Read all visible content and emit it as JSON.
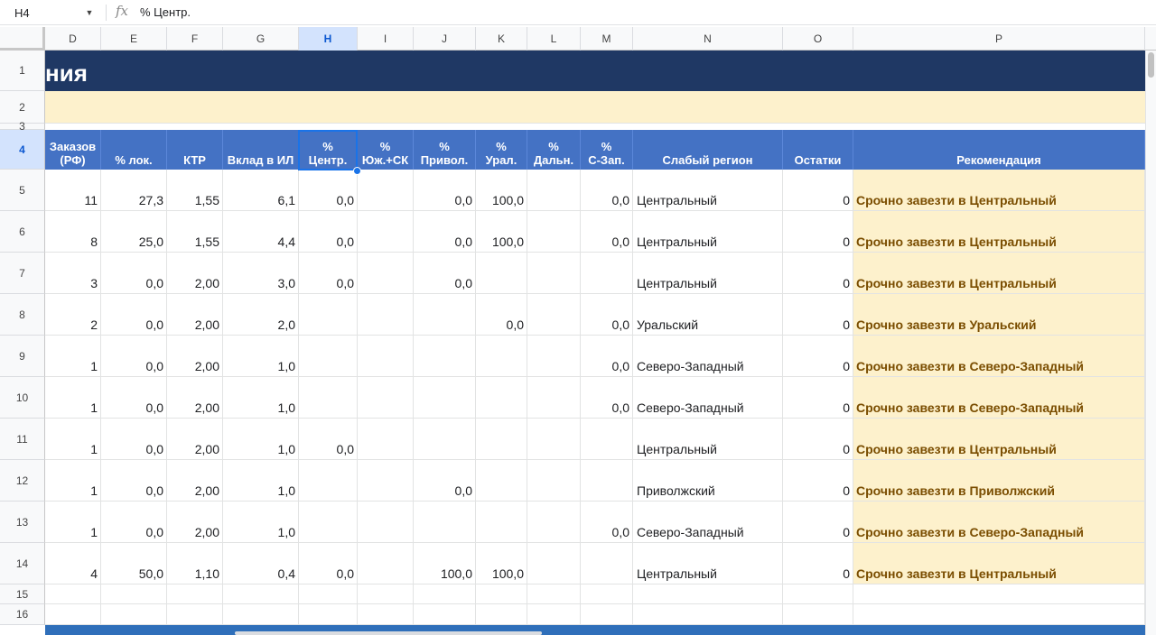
{
  "formula_bar": {
    "cell_ref": "H4",
    "fx_symbol": "fx",
    "formula": "% Центр."
  },
  "columns": [
    {
      "letter": "D",
      "selected": false
    },
    {
      "letter": "E",
      "selected": false
    },
    {
      "letter": "F",
      "selected": false
    },
    {
      "letter": "G",
      "selected": false
    },
    {
      "letter": "H",
      "selected": true
    },
    {
      "letter": "I",
      "selected": false
    },
    {
      "letter": "J",
      "selected": false
    },
    {
      "letter": "K",
      "selected": false
    },
    {
      "letter": "L",
      "selected": false
    },
    {
      "letter": "M",
      "selected": false
    },
    {
      "letter": "N",
      "selected": false
    },
    {
      "letter": "O",
      "selected": false
    },
    {
      "letter": "P",
      "selected": false
    }
  ],
  "row_numbers": [
    "1",
    "2",
    "3",
    "4",
    "5",
    "6",
    "7",
    "8",
    "9",
    "10",
    "11",
    "12",
    "13",
    "14",
    "15",
    "16"
  ],
  "selected_row": "4",
  "sheet": {
    "title_fragment": "ния",
    "colors": {
      "title_bg": "#1f3864",
      "header_bg": "#4472c4",
      "recommendation_bg": "#fdf1cc",
      "recommendation_text": "#7a4d00",
      "selection": "#1a73e8"
    },
    "headers": [
      "Заказов\n(РФ)",
      "% лок.",
      "КТР",
      "Вклад в ИЛ",
      "%\nЦентр.",
      "%\nЮж.+СК",
      "%\nПривол.",
      "%\nУрал.",
      "%\nДальн.",
      "%\nС-Зап.",
      "Слабый регион",
      "Остатки",
      "Рекомендация"
    ],
    "rows": [
      [
        "11",
        "27,3",
        "1,55",
        "6,1",
        "0,0",
        "",
        "0,0",
        "100,0",
        "",
        "0,0",
        "Центральный",
        "0",
        "Срочно завезти в Центральный"
      ],
      [
        "8",
        "25,0",
        "1,55",
        "4,4",
        "0,0",
        "",
        "0,0",
        "100,0",
        "",
        "0,0",
        "Центральный",
        "0",
        "Срочно завезти в Центральный"
      ],
      [
        "3",
        "0,0",
        "2,00",
        "3,0",
        "0,0",
        "",
        "0,0",
        "",
        "",
        "",
        "Центральный",
        "0",
        "Срочно завезти в Центральный"
      ],
      [
        "2",
        "0,0",
        "2,00",
        "2,0",
        "",
        "",
        "",
        "0,0",
        "",
        "0,0",
        "Уральский",
        "0",
        "Срочно завезти в Уральский"
      ],
      [
        "1",
        "0,0",
        "2,00",
        "1,0",
        "",
        "",
        "",
        "",
        "",
        "0,0",
        "Северо-Западный",
        "0",
        "Срочно завезти в Северо-Западный"
      ],
      [
        "1",
        "0,0",
        "2,00",
        "1,0",
        "",
        "",
        "",
        "",
        "",
        "0,0",
        "Северо-Западный",
        "0",
        "Срочно завезти в Северо-Западный"
      ],
      [
        "1",
        "0,0",
        "2,00",
        "1,0",
        "0,0",
        "",
        "",
        "",
        "",
        "",
        "Центральный",
        "0",
        "Срочно завезти в Центральный"
      ],
      [
        "1",
        "0,0",
        "2,00",
        "1,0",
        "",
        "",
        "0,0",
        "",
        "",
        "",
        "Приволжский",
        "0",
        "Срочно завезти в Приволжский"
      ],
      [
        "1",
        "0,0",
        "2,00",
        "1,0",
        "",
        "",
        "",
        "",
        "",
        "0,0",
        "Северо-Западный",
        "0",
        "Срочно завезти в Северо-Западный"
      ],
      [
        "4",
        "50,0",
        "1,10",
        "0,4",
        "0,0",
        "",
        "100,0",
        "100,0",
        "",
        "",
        "Центральный",
        "0",
        "Срочно завезти в Центральный"
      ]
    ]
  }
}
